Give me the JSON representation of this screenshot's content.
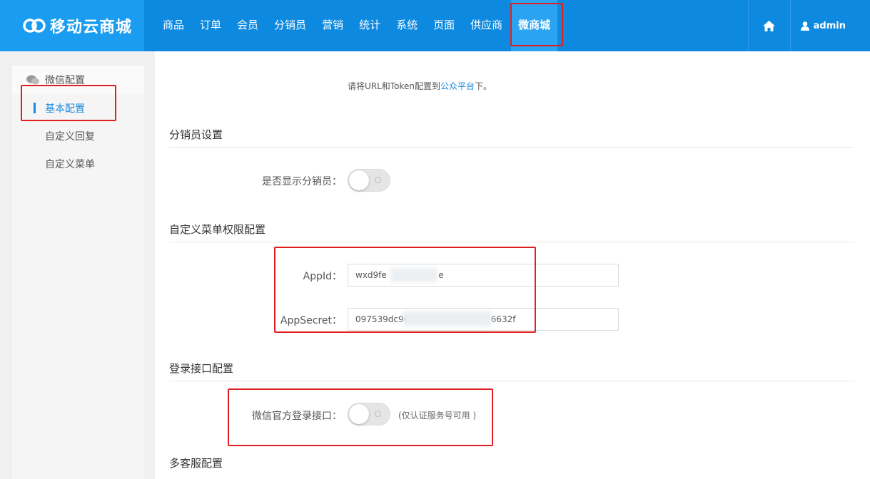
{
  "header": {
    "logo_text": "移动云商城",
    "nav": [
      {
        "label": "商品",
        "active": false
      },
      {
        "label": "订单",
        "active": false
      },
      {
        "label": "会员",
        "active": false
      },
      {
        "label": "分销员",
        "active": false
      },
      {
        "label": "营销",
        "active": false
      },
      {
        "label": "统计",
        "active": false
      },
      {
        "label": "系统",
        "active": false
      },
      {
        "label": "页面",
        "active": false
      },
      {
        "label": "供应商",
        "active": false
      },
      {
        "label": "微商城",
        "active": true
      }
    ],
    "user": "admin"
  },
  "sidebar": {
    "group_label": "微信配置",
    "items": [
      {
        "label": "基本配置",
        "active": true
      },
      {
        "label": "自定义回复",
        "active": false
      },
      {
        "label": "自定义菜单",
        "active": false
      }
    ]
  },
  "main": {
    "notice": {
      "prefix": "请将URL和Token配置到",
      "link": "公众平台",
      "suffix": "下。"
    },
    "distributor": {
      "title": "分销员设置",
      "show_label": "是否显示分销员：",
      "show_enabled": false
    },
    "menu_auth": {
      "title": "自定义菜单权限配置",
      "appid_label": "AppId：",
      "appid_value": "wxd9fe                   e",
      "secret_label": "AppSecret：",
      "secret_value": "097539dc96                              6632f"
    },
    "login": {
      "title": "登录接口配置",
      "wechat_login_label": "微信官方登录接口：",
      "wechat_login_enabled": false,
      "hint": "(仅认证服务号可用 )"
    },
    "customer_service": {
      "title": "多客服配置"
    }
  },
  "colors": {
    "topbar": "#0d8ae0",
    "accent": "#1a8cdf",
    "annotation": "#e02020"
  }
}
